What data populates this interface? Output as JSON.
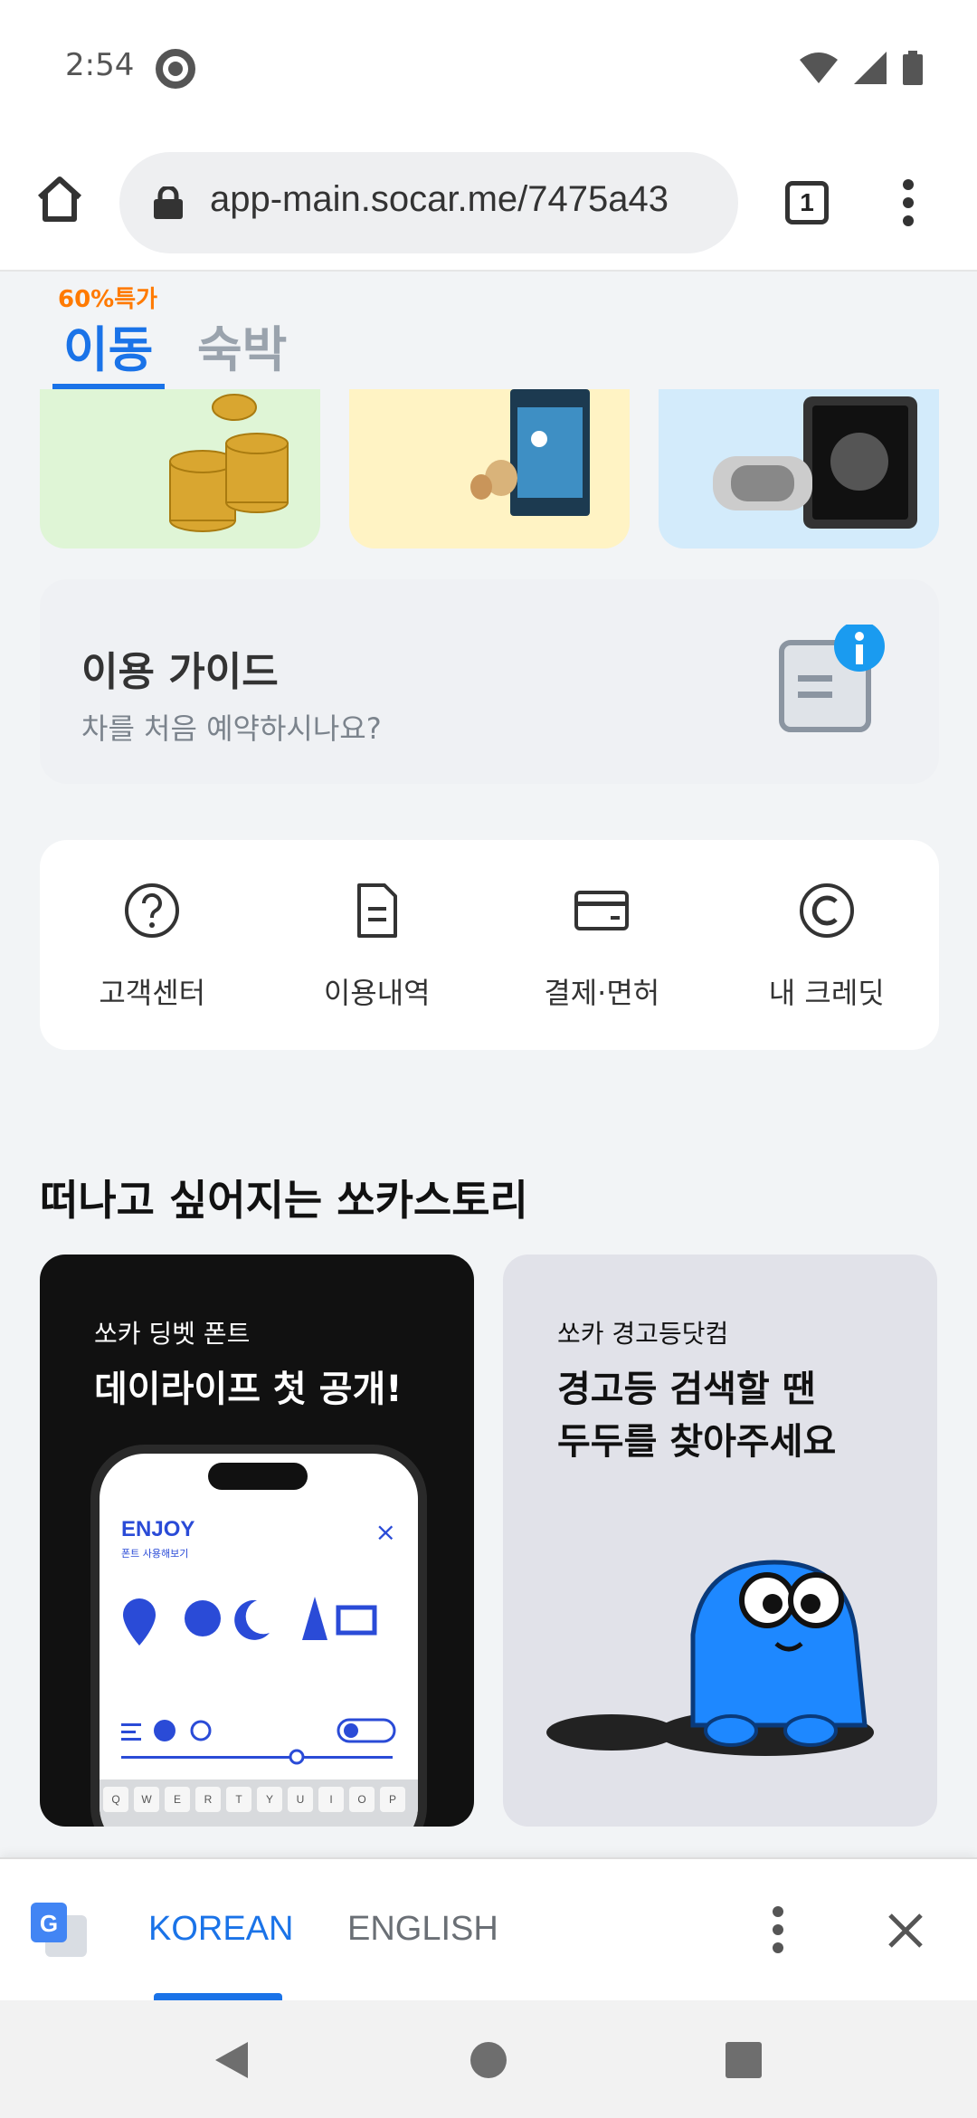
{
  "status_bar": {
    "time": "2:54"
  },
  "browser": {
    "url": "app-main.socar.me/7475a43",
    "tab_count": "1"
  },
  "tabs": {
    "promo_badge": "60%특가",
    "move": "이동",
    "stay": "숙박"
  },
  "guide": {
    "title": "이용 가이드",
    "subtitle": "차를 처음 예약하시나요?"
  },
  "menu": [
    {
      "label": "고객센터",
      "icon": "help-circle-icon"
    },
    {
      "label": "이용내역",
      "icon": "document-icon"
    },
    {
      "label": "결제·면허",
      "icon": "card-icon"
    },
    {
      "label": "내 크레딧",
      "icon": "credit-c-icon"
    }
  ],
  "story": {
    "section_title": "떠나고 싶어지는 쏘카스토리",
    "cards": [
      {
        "small": "쏘카 딩벳 폰트",
        "big_line1": "데이라이프 첫 공개!",
        "big_line2": ""
      },
      {
        "small": "쏘카 경고등닷컴",
        "big_line1": "경고등 검색할 땐",
        "big_line2": "두두를 찾아주세요"
      }
    ],
    "phone": {
      "enjoy": "ENJOY",
      "enjoy_sub": "폰트 사용해보기",
      "close": "×",
      "keys": [
        "Q",
        "W",
        "E",
        "R",
        "T",
        "Y",
        "U",
        "I",
        "O",
        "P"
      ]
    }
  },
  "translate_bar": {
    "lang_active": "KOREAN",
    "lang_other": "ENGLISH"
  },
  "colors": {
    "accent": "#1a73e8",
    "promo_orange": "#ff7a00",
    "inactive_tab": "#9aa3ad"
  }
}
